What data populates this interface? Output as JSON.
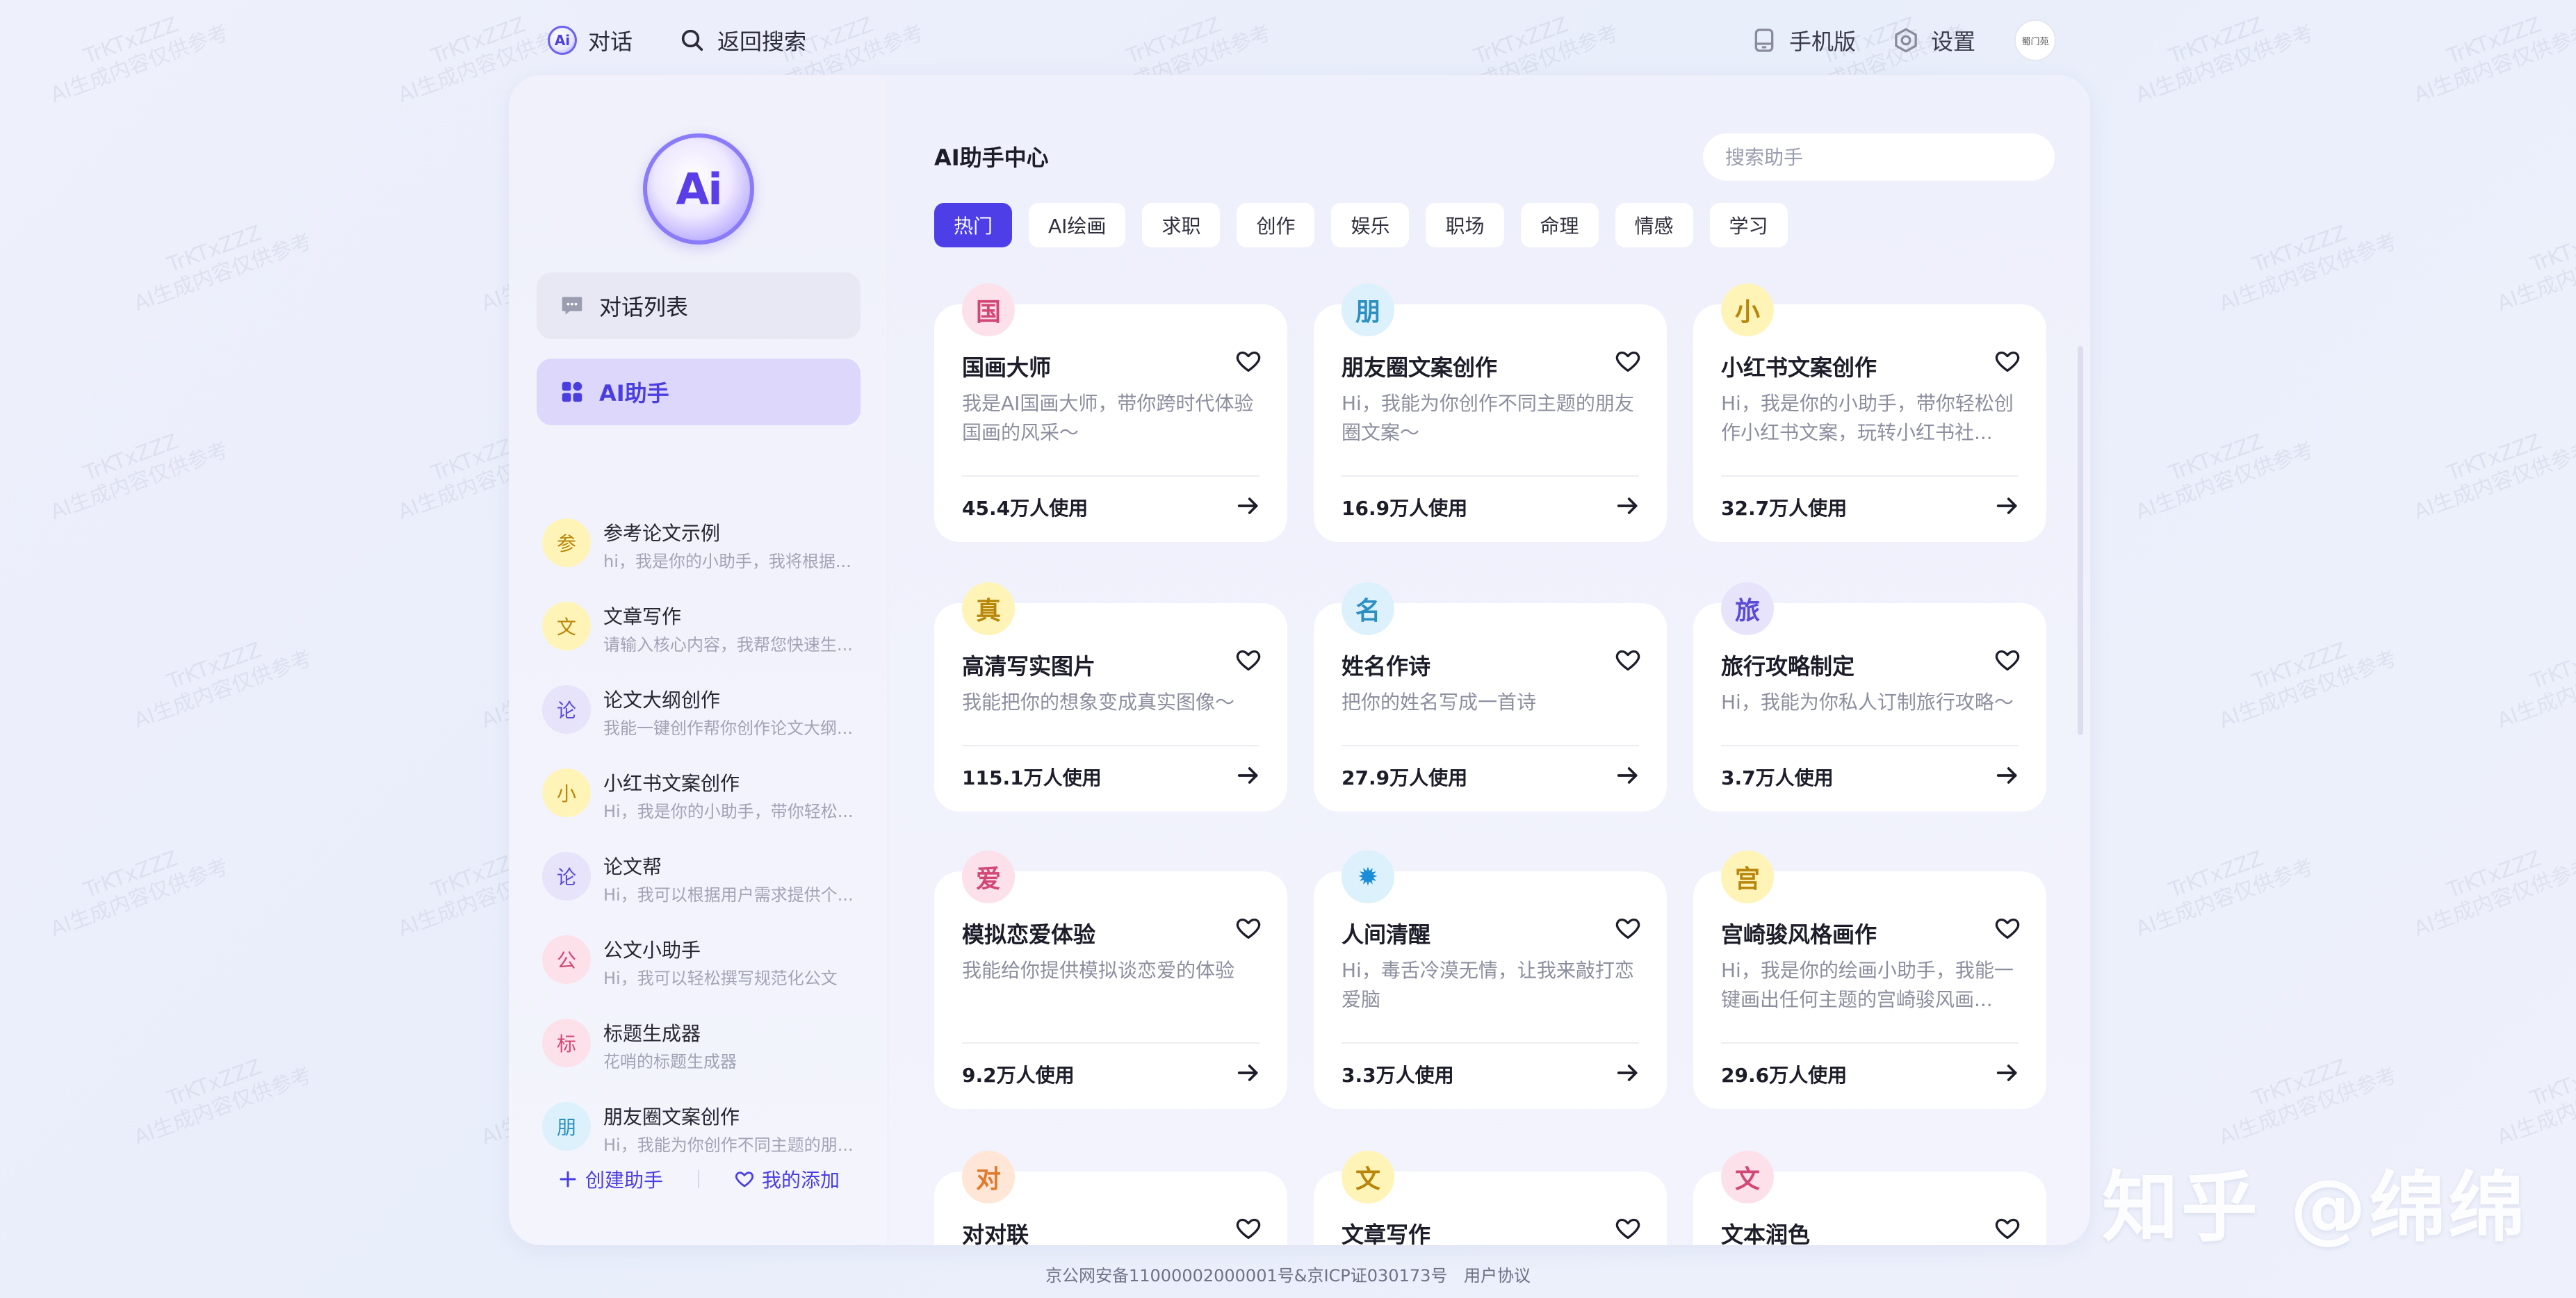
{
  "topbar": {
    "chat_label": "对话",
    "back_search_label": "返回搜索",
    "mobile_label": "手机版",
    "settings_label": "设置",
    "avatar_text": "蜀门苑"
  },
  "sidebar": {
    "logo_text": "Ai",
    "chat_list_label": "对话列表",
    "ai_assistant_label": "AI助手",
    "items": [
      {
        "char": "参",
        "name": "参考论文示例",
        "desc": "hi，我是你的小助手，我将根据...",
        "bg": "#fff4b8",
        "fg": "#b8860b"
      },
      {
        "char": "文",
        "name": "文章写作",
        "desc": "请输入核心内容，我帮您快速生...",
        "bg": "#fff4b8",
        "fg": "#b8860b"
      },
      {
        "char": "论",
        "name": "论文大纲创作",
        "desc": "我能一键创作帮你创作论文大纲...",
        "bg": "#e6e3fb",
        "fg": "#5a4ad6"
      },
      {
        "char": "小",
        "name": "小红书文案创作",
        "desc": "Hi，我是你的小助手，带你轻松...",
        "bg": "#fff4b8",
        "fg": "#b8860b"
      },
      {
        "char": "论",
        "name": "论文帮",
        "desc": "Hi，我可以根据用户需求提供个...",
        "bg": "#e6e3fb",
        "fg": "#5a4ad6"
      },
      {
        "char": "公",
        "name": "公文小助手",
        "desc": "Hi，我可以轻松撰写规范化公文",
        "bg": "#fde1ea",
        "fg": "#d14875"
      },
      {
        "char": "标",
        "name": "标题生成器",
        "desc": "花哨的标题生成器",
        "bg": "#fde1ea",
        "fg": "#d14875"
      },
      {
        "char": "朋",
        "name": "朋友圈文案创作",
        "desc": "Hi，我能为你创作不同主题的朋...",
        "bg": "#dcf1fb",
        "fg": "#2b8fc2"
      }
    ],
    "create_label": "创建助手",
    "my_added_label": "我的添加"
  },
  "content": {
    "title": "AI助手中心",
    "search_placeholder": "搜索助手",
    "tabs": [
      "热门",
      "AI绘画",
      "求职",
      "创作",
      "娱乐",
      "职场",
      "命理",
      "情感",
      "学习"
    ],
    "cards": [
      {
        "char": "国",
        "title": "国画大师",
        "desc": "我是AI国画大师，带你跨时代体验国画的风采～",
        "uses": "45.4万人使用",
        "bg": "#fde1ea",
        "fg": "#d14875"
      },
      {
        "char": "朋",
        "title": "朋友圈文案创作",
        "desc": "Hi，我能为你创作不同主题的朋友圈文案～",
        "uses": "16.9万人使用",
        "bg": "#dcf1fb",
        "fg": "#2b8fc2"
      },
      {
        "char": "小",
        "title": "小红书文案创作",
        "desc": "Hi，我是你的小助手，带你轻松创作小红书文案，玩转小红书社...",
        "uses": "32.7万人使用",
        "bg": "#fff4b8",
        "fg": "#b8860b"
      },
      {
        "char": "真",
        "title": "高清写实图片",
        "desc": "我能把你的想象变成真实图像～",
        "uses": "115.1万人使用",
        "bg": "#fff4b8",
        "fg": "#b8860b"
      },
      {
        "char": "名",
        "title": "姓名作诗",
        "desc": "把你的姓名写成一首诗",
        "uses": "27.9万人使用",
        "bg": "#dcf1fb",
        "fg": "#2b8fc2"
      },
      {
        "char": "旅",
        "title": "旅行攻略制定",
        "desc": "Hi，我能为你私人订制旅行攻略～",
        "uses": "3.7万人使用",
        "bg": "#e6e3fb",
        "fg": "#5a4ad6"
      },
      {
        "char": "爱",
        "title": "模拟恋爱体验",
        "desc": "我能给你提供模拟谈恋爱的体验",
        "uses": "9.2万人使用",
        "bg": "#fde1ea",
        "fg": "#d14875"
      },
      {
        "char": "✹",
        "title": "人间清醒",
        "desc": "Hi，毒舌冷漠无情，让我来敲打恋爱脑",
        "uses": "3.3万人使用",
        "bg": "#dcf1fb",
        "fg": "#1a8cd8"
      },
      {
        "char": "宫",
        "title": "宫崎骏风格画作",
        "desc": "Hi，我是你的绘画小助手，我能一键画出任何主题的宫崎骏风画...",
        "uses": "29.6万人使用",
        "bg": "#fff4b8",
        "fg": "#b8860b"
      },
      {
        "char": "对",
        "title": "对对联",
        "desc": "",
        "uses": "",
        "bg": "#ffe6d6",
        "fg": "#e07a2e"
      },
      {
        "char": "文",
        "title": "文章写作",
        "desc": "",
        "uses": "",
        "bg": "#fff4b8",
        "fg": "#b8860b"
      },
      {
        "char": "文",
        "title": "文本润色",
        "desc": "",
        "uses": "",
        "bg": "#fde1ea",
        "fg": "#d14875"
      }
    ]
  },
  "footer": {
    "icp": "京公网安备11000002000001号&京ICP证030173号",
    "agreement": "用户协议"
  },
  "watermark": {
    "line1": "TrKTxZZZ",
    "line2": "AI生成内容仅供参考"
  },
  "brand_mark": "知乎 @绵绵",
  "colors": {
    "accent": "#4d3ee8",
    "page_bg": "#eef0fb"
  }
}
